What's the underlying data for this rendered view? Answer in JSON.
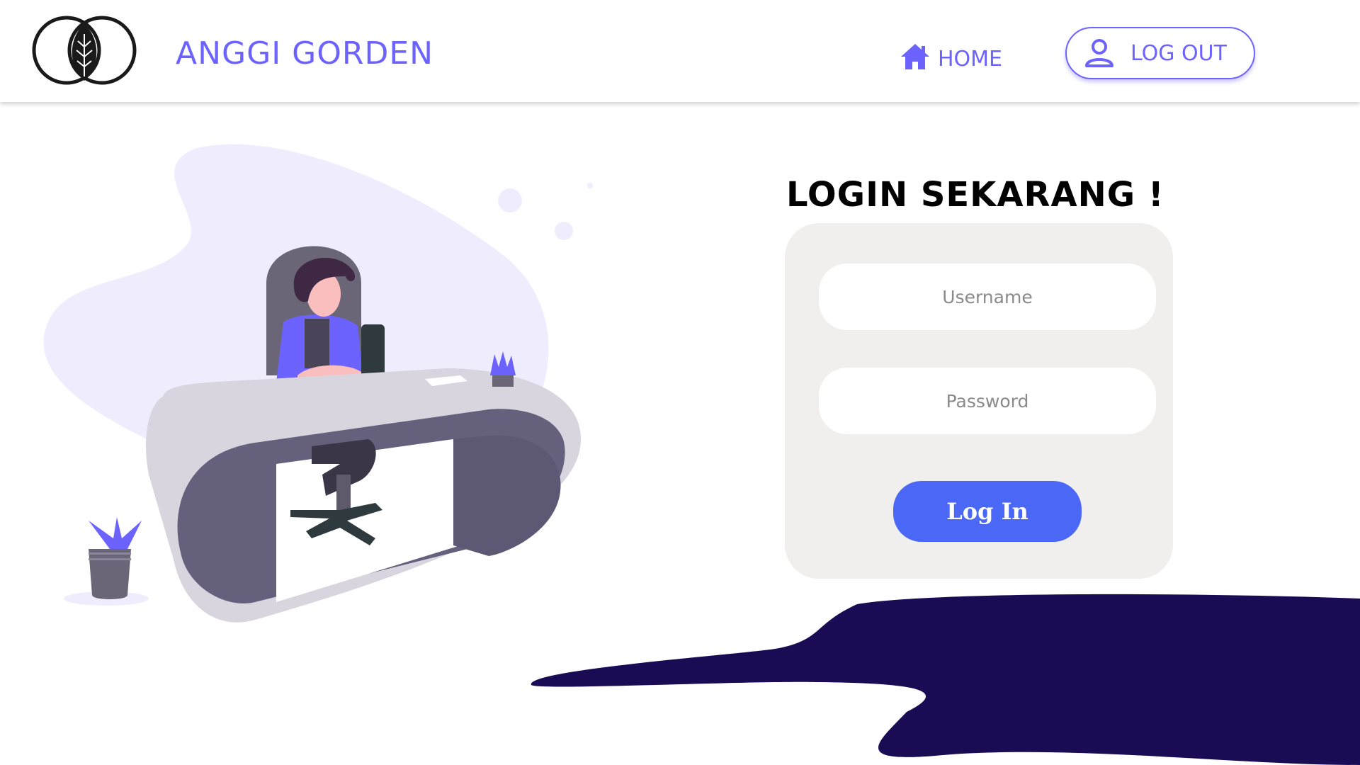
{
  "header": {
    "brand": "ANGGI GORDEN",
    "nav": {
      "home_label": "HOME",
      "home_icon": "home-icon",
      "logout_label": "LOG OUT",
      "logout_icon": "user-icon"
    }
  },
  "login": {
    "title": "LOGIN SEKARANG !",
    "username_placeholder": "Username",
    "password_placeholder": "Password",
    "submit_label": "Log In"
  },
  "colors": {
    "accent": "#6c63ff",
    "button": "#4a68f5",
    "card": "#f1eeee",
    "wave": "#1a0b54"
  }
}
